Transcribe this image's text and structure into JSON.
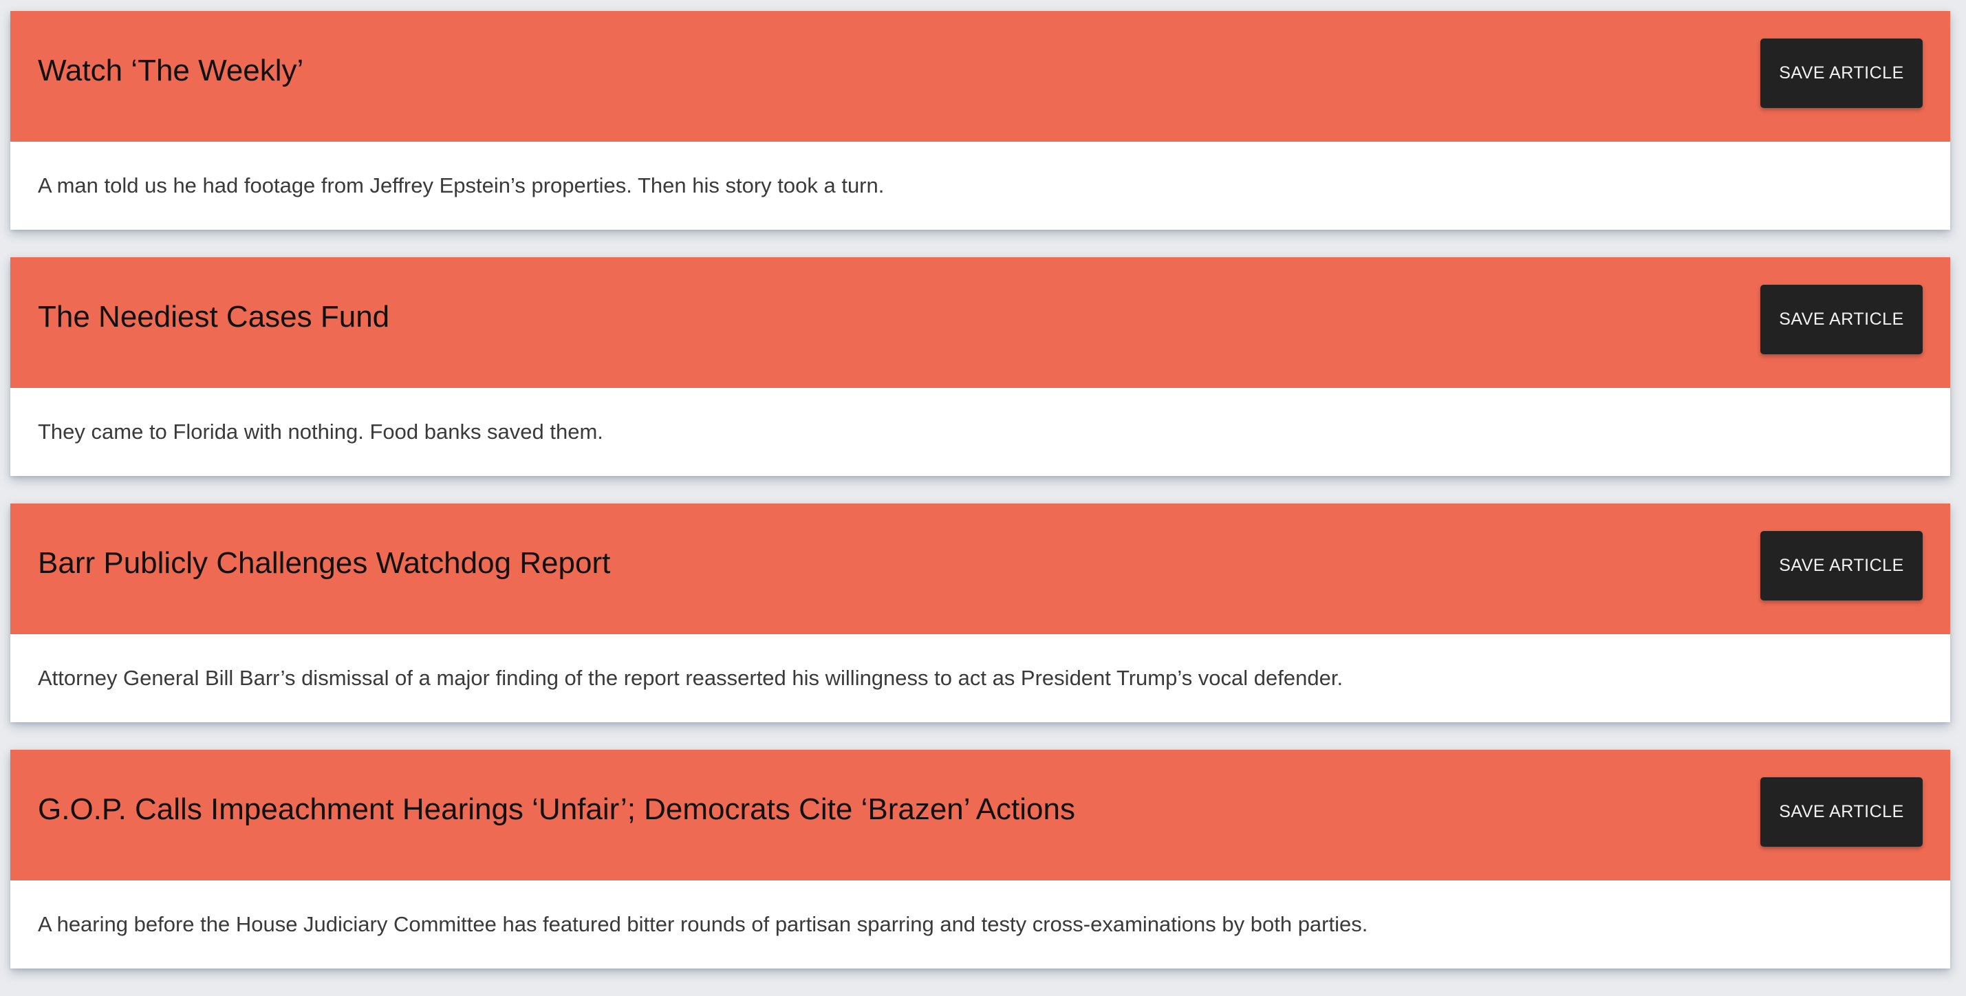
{
  "articles": [
    {
      "title": "Watch ‘The Weekly’",
      "summary": "A man told us he had footage from Jeffrey Epstein’s properties. Then his story took a turn.",
      "save_label": "SAVE ARTICLE"
    },
    {
      "title": "The Neediest Cases Fund",
      "summary": "They came to Florida with nothing. Food banks saved them.",
      "save_label": "SAVE ARTICLE"
    },
    {
      "title": "Barr Publicly Challenges Watchdog Report",
      "summary": "Attorney General Bill Barr’s dismissal of a major finding of the report reasserted his willingness to act as President Trump’s vocal defender.",
      "save_label": "SAVE ARTICLE"
    },
    {
      "title": "G.O.P. Calls Impeachment Hearings ‘Unfair’; Democrats Cite ‘Brazen’ Actions",
      "summary": "A hearing before the House Judiciary Committee has featured bitter rounds of partisan sparring and testy cross-examinations by both parties.",
      "save_label": "SAVE ARTICLE"
    }
  ],
  "colors": {
    "header_bg": "#ee6a52",
    "button_bg": "#222222",
    "page_bg": "#e9ebee"
  }
}
